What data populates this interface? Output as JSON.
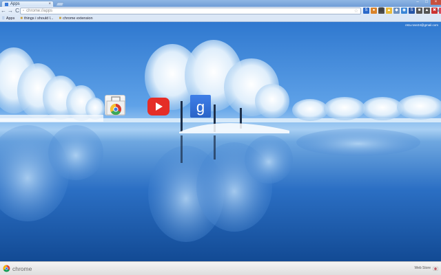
{
  "tab": {
    "title": "Apps",
    "close": "×"
  },
  "window": {
    "minimize": "–",
    "maximize": "□",
    "close": "×"
  },
  "toolbar": {
    "back": "←",
    "forward": "→",
    "reload": "C",
    "url": "chrome://apps",
    "page_icon": "▫",
    "star": "☆",
    "menu": "≡"
  },
  "extensions": [
    {
      "name": "ext-1",
      "glyph": "S",
      "color": "#2a68c9"
    },
    {
      "name": "ext-2",
      "glyph": "●",
      "color": "#d9832b"
    },
    {
      "name": "ext-3",
      "glyph": "⬛",
      "color": "#4e4e4e"
    },
    {
      "name": "ext-4",
      "glyph": "▲",
      "color": "#e8b93a"
    },
    {
      "name": "ext-5",
      "glyph": "◆",
      "color": "#6a8fbf"
    },
    {
      "name": "ext-6",
      "glyph": "◉",
      "color": "#3a86d6"
    },
    {
      "name": "ext-7",
      "glyph": "S",
      "color": "#2454a6"
    },
    {
      "name": "ext-8",
      "glyph": "■",
      "color": "#555555"
    },
    {
      "name": "ext-9",
      "glyph": "▲",
      "color": "#555555"
    },
    {
      "name": "ext-10",
      "glyph": "✖",
      "color": "#cc3333"
    },
    {
      "name": "ext-11",
      "glyph": "♥",
      "color": "#d94b5a"
    }
  ],
  "bookmarks": [
    {
      "icon": "⁝⁝",
      "label": "Apps"
    },
    {
      "icon": "■",
      "label": "things i should l..."
    },
    {
      "icon": "■",
      "label": "chrome extension"
    }
  ],
  "account": {
    "email": "reta.rose24@gmail.com"
  },
  "apps": [
    {
      "name": "Chrome Web Store"
    },
    {
      "name": "YouTube"
    },
    {
      "name": "Google Search"
    }
  ],
  "bottom": {
    "brand": "chrome",
    "webstore": "Web Store"
  },
  "colors": {
    "youtube": "#e52d27",
    "google": "#3f7fe8",
    "sky": "#2f78cf"
  }
}
